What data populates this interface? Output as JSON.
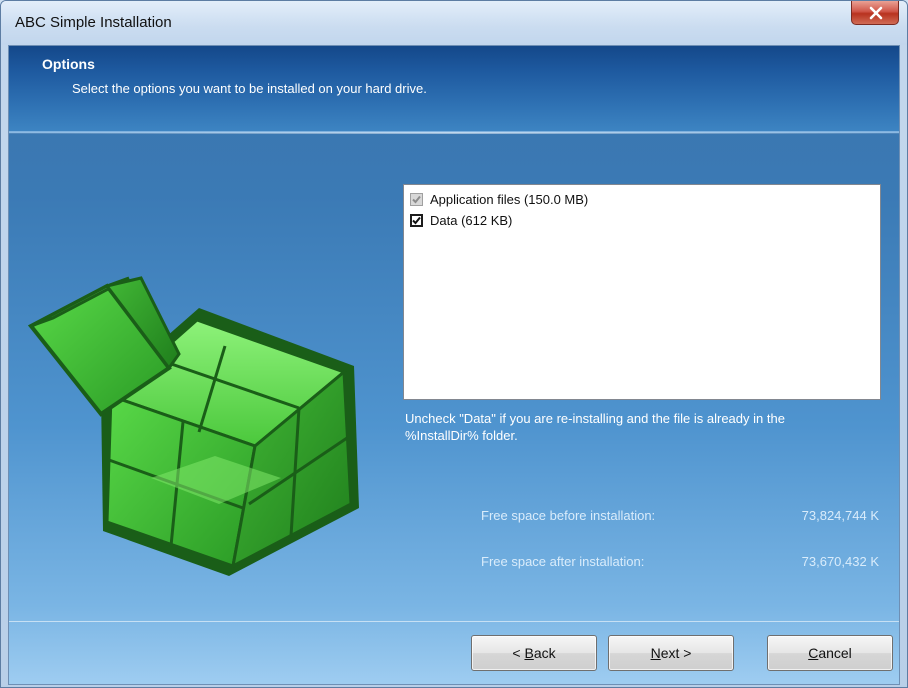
{
  "window": {
    "title": "ABC Simple Installation"
  },
  "header": {
    "title": "Options",
    "subtitle": "Select the options you want to be installed on your hard drive."
  },
  "options": [
    {
      "label": "Application files (150.0 MB)",
      "checked": true,
      "enabled": false
    },
    {
      "label": "Data (612 KB)",
      "checked": true,
      "enabled": true
    }
  ],
  "hint": {
    "line1": "Uncheck \"Data\"  if you are re-installing and the file is already in the",
    "line2": "%InstallDir% folder."
  },
  "space": {
    "before_label": "Free space before installation:",
    "before_value": "73,824,744 K",
    "after_label": "Free space after installation:",
    "after_value": "73,670,432 K"
  },
  "buttons": {
    "back_prefix": "< ",
    "back_mnemonic": "B",
    "back_rest": "ack",
    "next_mnemonic": "N",
    "next_rest": "ext >",
    "cancel_mnemonic": "C",
    "cancel_rest": "ancel"
  },
  "icons": {
    "logo": "green-cubes-icon",
    "close": "close-icon",
    "checkbox": "checkmark-icon"
  },
  "colors": {
    "header": "#1e5aa0",
    "cube_green": "#3ec43a",
    "close_red": "#c9452f"
  }
}
